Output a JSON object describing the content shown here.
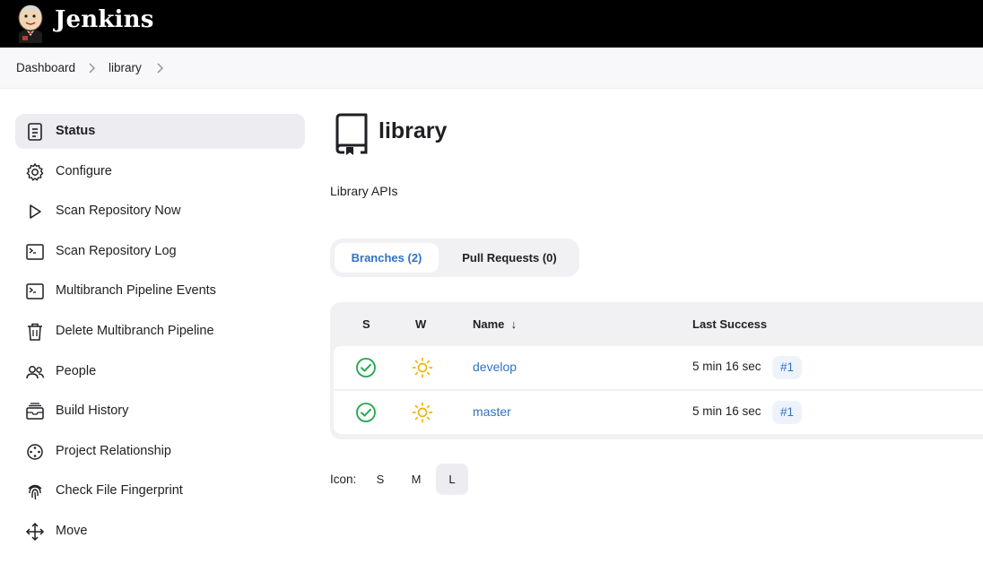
{
  "header": {
    "brand": "Jenkins"
  },
  "breadcrumb": [
    {
      "label": "Dashboard"
    },
    {
      "label": "library"
    }
  ],
  "sidebar": {
    "items": [
      {
        "label": "Status",
        "icon": "document-icon",
        "active": true
      },
      {
        "label": "Configure",
        "icon": "gear-icon"
      },
      {
        "label": "Scan Repository Now",
        "icon": "play-icon"
      },
      {
        "label": "Scan Repository Log",
        "icon": "terminal-icon"
      },
      {
        "label": "Multibranch Pipeline Events",
        "icon": "terminal-icon"
      },
      {
        "label": "Delete Multibranch Pipeline",
        "icon": "trash-icon"
      },
      {
        "label": "People",
        "icon": "people-icon"
      },
      {
        "label": "Build History",
        "icon": "history-icon"
      },
      {
        "label": "Project Relationship",
        "icon": "relationship-icon"
      },
      {
        "label": "Check File Fingerprint",
        "icon": "fingerprint-icon"
      },
      {
        "label": "Move",
        "icon": "move-icon"
      }
    ]
  },
  "project": {
    "title": "library",
    "description": "Library APIs",
    "icon": "repository-icon"
  },
  "tabs": [
    {
      "label": "Branches (2)",
      "active": true
    },
    {
      "label": "Pull Requests (0)",
      "active": false
    }
  ],
  "table": {
    "headers": {
      "s": "S",
      "w": "W",
      "name": "Name  ↓",
      "last_success": "Last Success"
    },
    "rows": [
      {
        "status": "success-icon",
        "weather": "sunny-icon",
        "name": "develop",
        "last_success": "5 min 16 sec",
        "build": "#1"
      },
      {
        "status": "success-icon",
        "weather": "sunny-icon",
        "name": "master",
        "last_success": "5 min 16 sec",
        "build": "#1"
      }
    ]
  },
  "icon_size": {
    "label": "Icon:",
    "options": [
      "S",
      "M",
      "L"
    ],
    "selected": "L"
  },
  "colors": {
    "header_bg": "#000000",
    "link": "#2f73c6",
    "success": "#1ea64b",
    "weather": "#f0b400",
    "active_bg": "#ececf1"
  }
}
